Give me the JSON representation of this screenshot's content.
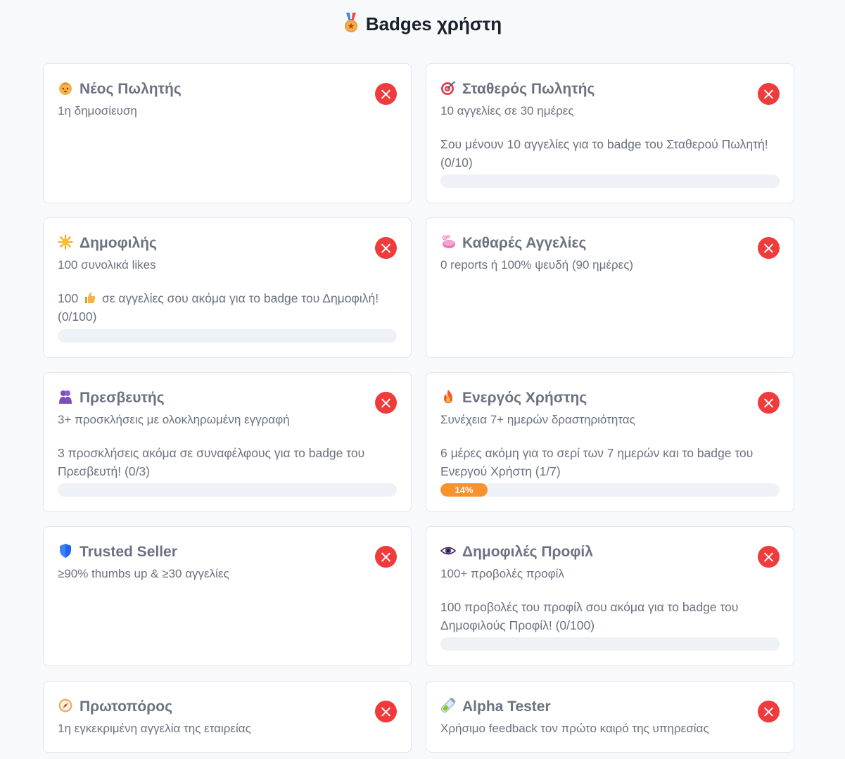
{
  "page": {
    "title": "Badges χρήστη",
    "title_icon": "medal-icon"
  },
  "colors": {
    "error_red": "#ef3b3b",
    "progress_orange": "#f7922e",
    "track": "#eef1f5",
    "title_text": "#6b7280"
  },
  "badges": [
    {
      "title": "Νέος Πωλητής",
      "icon": "baby-face-icon",
      "desc": "1η δημοσίευση",
      "message": "",
      "earned": false
    },
    {
      "title": "Σταθερός Πωλητής",
      "icon": "target-icon",
      "desc": "10 αγγελίες σε 30 ημέρες",
      "message": "Σου μένουν 10 αγγελίες για το badge του Σταθερού Πωλητή! (0/10)",
      "progress_percent": 0,
      "progress_label": "",
      "earned": false
    },
    {
      "title": "Δημοφιλής",
      "icon": "sun-icon",
      "desc": "100 συνολικά likes",
      "message_part1": "100",
      "message_icon": "thumbs-up-icon",
      "message_part2": "σε αγγελίες σου ακόμα για το badge του Δημοφιλή! (0/100)",
      "progress_percent": 0,
      "progress_label": "",
      "earned": false
    },
    {
      "title": "Καθαρές Αγγελίες",
      "icon": "soap-icon",
      "desc": "0 reports ή 100% ψευδή (90 ημέρες)",
      "message": "",
      "earned": false
    },
    {
      "title": "Πρεσβευτής",
      "icon": "people-hugging-icon",
      "desc": "3+ προσκλήσεις με ολοκληρωμένη εγγραφή",
      "message": "3 προσκλήσεις ακόμα σε συναφέλφους για το badge του Πρεσβευτή! (0/3)",
      "progress_percent": 0,
      "progress_label": "",
      "earned": false
    },
    {
      "title": "Ενεργός Χρήστης",
      "icon": "fire-icon",
      "desc": "Συνέχεια 7+ ημερών δραστηριότητας",
      "message": "6 μέρες ακόμη για το σερί των 7 ημερών και το badge του Ενεργού Χρήστη (1/7)",
      "progress_percent": 14,
      "progress_label": "14%",
      "earned": false
    },
    {
      "title": "Trusted Seller",
      "icon": "shield-icon",
      "desc": "≥90% thumbs up & ≥30 αγγελίες",
      "message": "",
      "earned": false
    },
    {
      "title": "Δημοφιλές Προφίλ",
      "icon": "eye-icon",
      "desc": "100+ προβολές προφίλ",
      "message": "100 προβολές του προφίλ σου ακόμα για το badge του Δημοφιλούς Προφίλ! (0/100)",
      "progress_percent": 0,
      "progress_label": "",
      "earned": false
    },
    {
      "title": "Πρωτοπόρος",
      "icon": "compass-icon",
      "desc": "1η εγκεκριμένη αγγελία της εταιρείας",
      "message": "",
      "earned": false
    },
    {
      "title": "Alpha Tester",
      "icon": "test-tube-icon",
      "desc": "Χρήσιμο feedback τον πρώτο καιρό της υπηρεσίας",
      "message": "",
      "earned": false
    }
  ]
}
